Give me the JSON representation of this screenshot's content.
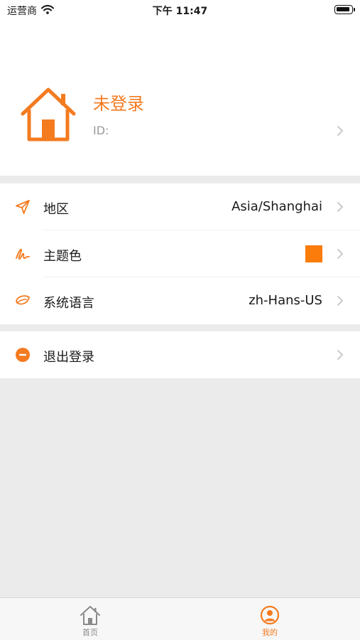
{
  "status_bar": {
    "carrier": "运营商",
    "time": "下午 11:47"
  },
  "profile": {
    "name": "未登录",
    "id_label": "ID:"
  },
  "settings": [
    {
      "key": "region",
      "label": "地区",
      "value": "Asia/Shanghai",
      "icon": "send-arrow-icon"
    },
    {
      "key": "theme",
      "label": "主题色",
      "value": "",
      "icon": "signature-icon",
      "swatch_color": "#fb7b0b"
    },
    {
      "key": "language",
      "label": "系统语言",
      "value": "zh-Hans-US",
      "icon": "leaf-icon"
    }
  ],
  "logout": {
    "label": "退出登录",
    "icon": "minus-circle-icon"
  },
  "tabbar": {
    "home_label": "首页",
    "mine_label": "我的",
    "active": "mine"
  },
  "colors": {
    "accent": "#f47b20",
    "swatch": "#fb7b0b",
    "background": "#ebebeb"
  }
}
